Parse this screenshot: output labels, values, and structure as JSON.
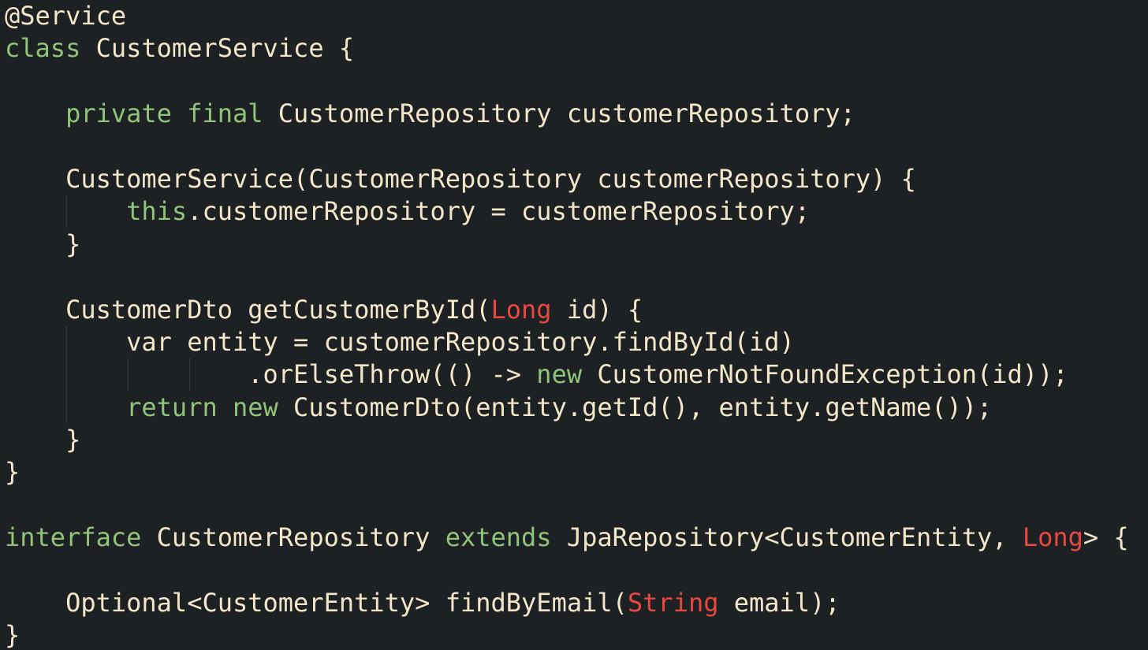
{
  "colors": {
    "background": "#1e2124",
    "keyword": "#8fc47a",
    "text": "#f2e7c9",
    "builtin_type": "#e8483f",
    "indent_guide": "#4a4e52"
  },
  "code_lines": [
    [
      {
        "t": "@Service",
        "k": "ann"
      }
    ],
    [
      {
        "t": "class",
        "k": "kw"
      },
      {
        "t": " CustomerService {",
        "k": "plain"
      }
    ],
    [],
    [
      {
        "t": "    ",
        "k": "plain"
      },
      {
        "t": "private",
        "k": "kw"
      },
      {
        "t": " ",
        "k": "plain"
      },
      {
        "t": "final",
        "k": "kw"
      },
      {
        "t": " CustomerRepository customerRepository;",
        "k": "plain"
      }
    ],
    [],
    [
      {
        "t": "    CustomerService(CustomerRepository customerRepository) {",
        "k": "plain"
      }
    ],
    [
      {
        "t": "        ",
        "k": "plain"
      },
      {
        "t": "this",
        "k": "kw"
      },
      {
        "t": ".customerRepository = customerRepository;",
        "k": "plain"
      }
    ],
    [
      {
        "t": "    }",
        "k": "plain"
      }
    ],
    [],
    [
      {
        "t": "    CustomerDto getCustomerById(",
        "k": "plain"
      },
      {
        "t": "Long",
        "k": "builtin"
      },
      {
        "t": " id) {",
        "k": "plain"
      }
    ],
    [
      {
        "t": "        var entity = customerRepository.findById(id)",
        "k": "plain"
      }
    ],
    [
      {
        "t": "                .orElseThrow(() -> ",
        "k": "plain"
      },
      {
        "t": "new",
        "k": "kw"
      },
      {
        "t": " CustomerNotFoundException(id));",
        "k": "plain"
      }
    ],
    [
      {
        "t": "        ",
        "k": "plain"
      },
      {
        "t": "return",
        "k": "kw"
      },
      {
        "t": " ",
        "k": "plain"
      },
      {
        "t": "new",
        "k": "kw"
      },
      {
        "t": " CustomerDto(entity.getId(), entity.getName());",
        "k": "plain"
      }
    ],
    [
      {
        "t": "    }",
        "k": "plain"
      }
    ],
    [
      {
        "t": "}",
        "k": "plain"
      }
    ],
    [],
    [
      {
        "t": "interface",
        "k": "kw"
      },
      {
        "t": " CustomerRepository ",
        "k": "plain"
      },
      {
        "t": "extends",
        "k": "kw"
      },
      {
        "t": " JpaRepository<CustomerEntity, ",
        "k": "plain"
      },
      {
        "t": "Long",
        "k": "builtin"
      },
      {
        "t": "> {",
        "k": "plain"
      }
    ],
    [],
    [
      {
        "t": "    Optional<CustomerEntity> findByEmail(",
        "k": "plain"
      },
      {
        "t": "String",
        "k": "builtin"
      },
      {
        "t": " email);",
        "k": "plain"
      }
    ],
    [
      {
        "t": "}",
        "k": "plain"
      }
    ]
  ]
}
